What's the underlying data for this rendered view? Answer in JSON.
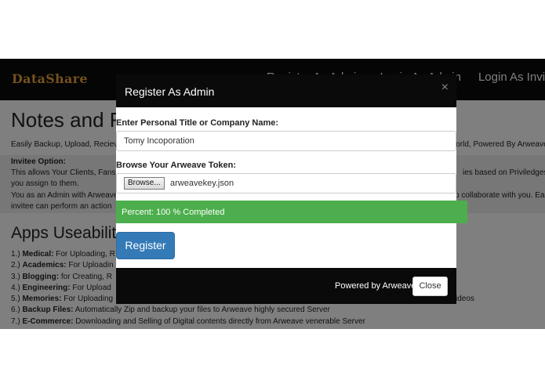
{
  "navbar": {
    "brand": "DataShare",
    "links": [
      "Register As Admin",
      "Login As Admin",
      "Login As Invitee"
    ]
  },
  "page": {
    "title": "Notes and Files Sharing",
    "intro_left": "Easily Backup, Upload, Recieve and Share Files",
    "intro_right": "world, Powered By Arweave",
    "invitee": {
      "heading": "Invitee Option:",
      "line1_left": "This allows Your Clients, Fans",
      "line1_right": "ies based on Priviledges",
      "line2": "you assign to them.",
      "line3_left": "You as an Admin with Arweave",
      "line3_right": "p collaborate with you. Each",
      "line4": "invitee can perform an action"
    },
    "apps_title": "Apps Useability",
    "apps": [
      {
        "num": "1.)",
        "name": "Medical:",
        "text": "For Uploading, R"
      },
      {
        "num": "2.)",
        "name": "Academics:",
        "text": "For Uploadin"
      },
      {
        "num": "3.)",
        "name": "Blogging:",
        "text": "for Creating, R"
      },
      {
        "num": "4.)",
        "name": "Engineering:",
        "text": "For Upload"
      },
      {
        "num": "5.)",
        "name": "Memories:",
        "text": "For Uploading"
      },
      {
        "num": "6.)",
        "name": "Backup Files:",
        "text": "Automatically Zip and backup your files to Arweave highly secured Server"
      },
      {
        "num": "7.)",
        "name": "E-Commerce:",
        "text": "Downloading and Selling of Digital contents directly from Arweave venerable Server"
      }
    ],
    "apps_suffix_5": "ideos"
  },
  "modal": {
    "title": "Register As Admin",
    "close_x": "×",
    "name_label": "Enter Personal Title or Company Name:",
    "name_value": "Tomy Incoporation",
    "token_label": "Browse Your Arweave Token:",
    "browse_label": "Browse...",
    "file_name": "arweavekey.json",
    "progress_percent": 100,
    "progress_text": "Percent: 100 % Completed",
    "register_label": "Register",
    "footer_text": "Powered by Arweave",
    "close_label": "Close"
  }
}
